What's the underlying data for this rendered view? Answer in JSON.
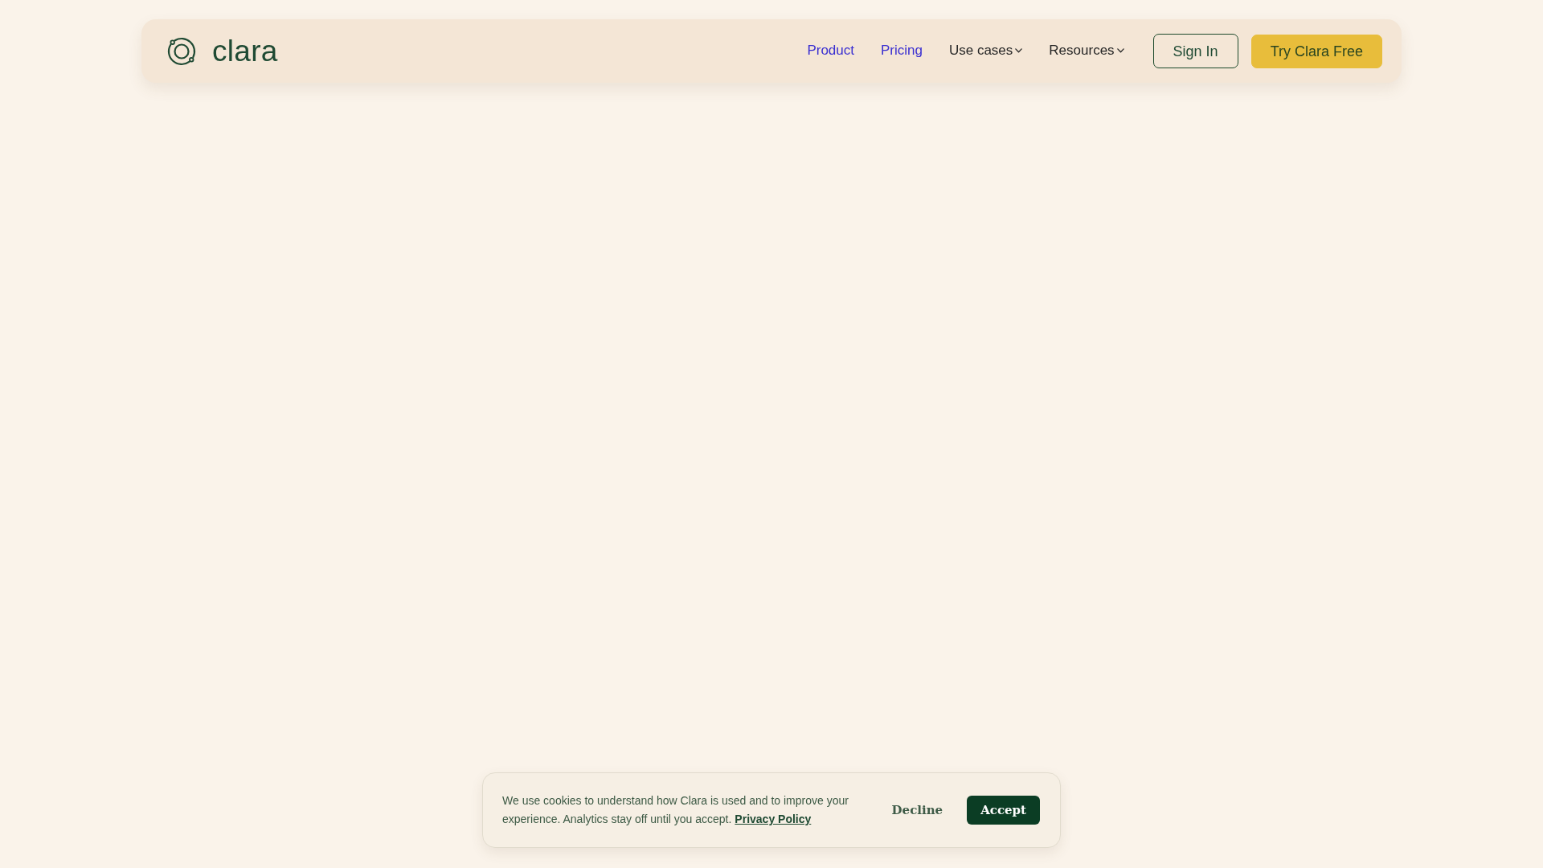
{
  "navbar": {
    "logo_text": "clara",
    "links": [
      {
        "label": "Product",
        "kind": "link"
      },
      {
        "label": "Pricing",
        "kind": "link"
      },
      {
        "label": "Use cases",
        "kind": "dropdown"
      },
      {
        "label": "Resources",
        "kind": "dropdown"
      }
    ],
    "buttons": [
      {
        "label": "Sign In",
        "kind": "outline"
      },
      {
        "label": "Try Clara Free",
        "kind": "primary"
      }
    ]
  },
  "cookie_banner": {
    "message": "We use cookies to understand how Clara is used and to improve your experience. Analytics stay off until you accept.",
    "link": "Privacy Policy",
    "buttons": [
      {
        "label": "Decline",
        "kind": "text"
      },
      {
        "label": "Accept",
        "kind": "solid"
      }
    ]
  }
}
